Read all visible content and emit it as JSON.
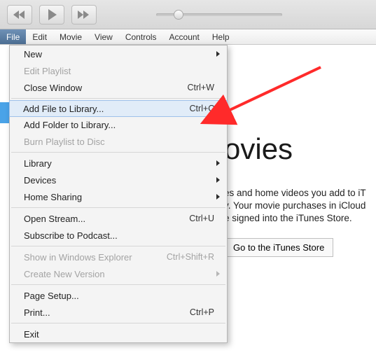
{
  "menubar": {
    "items": [
      "File",
      "Edit",
      "Movie",
      "View",
      "Controls",
      "Account",
      "Help"
    ],
    "active_index": 0
  },
  "dropdown": {
    "items": [
      {
        "label": "New",
        "submenu": true
      },
      {
        "label": "Edit Playlist",
        "disabled": true
      },
      {
        "label": "Close Window",
        "shortcut": "Ctrl+W"
      },
      {
        "sep": true
      },
      {
        "label": "Add File to Library...",
        "shortcut": "Ctrl+O",
        "highlight": true
      },
      {
        "label": "Add Folder to Library..."
      },
      {
        "label": "Burn Playlist to Disc",
        "disabled": true
      },
      {
        "sep": true
      },
      {
        "label": "Library",
        "submenu": true
      },
      {
        "label": "Devices",
        "submenu": true
      },
      {
        "label": "Home Sharing",
        "submenu": true
      },
      {
        "sep": true
      },
      {
        "label": "Open Stream...",
        "shortcut": "Ctrl+U"
      },
      {
        "label": "Subscribe to Podcast..."
      },
      {
        "sep": true
      },
      {
        "label": "Show in Windows Explorer",
        "shortcut": "Ctrl+Shift+R",
        "disabled": true
      },
      {
        "label": "Create New Version",
        "submenu": true,
        "disabled": true
      },
      {
        "sep": true
      },
      {
        "label": "Page Setup..."
      },
      {
        "label": "Print...",
        "shortcut": "Ctrl+P"
      },
      {
        "sep": true
      },
      {
        "label": "Exit"
      }
    ]
  },
  "page": {
    "title_fragment": "ovies",
    "body_line1": "es and home videos you add to iT",
    "body_line2": "y. Your movie purchases in iCloud",
    "body_line3": "e signed into the iTunes Store.",
    "store_button": "Go to the iTunes Store"
  }
}
